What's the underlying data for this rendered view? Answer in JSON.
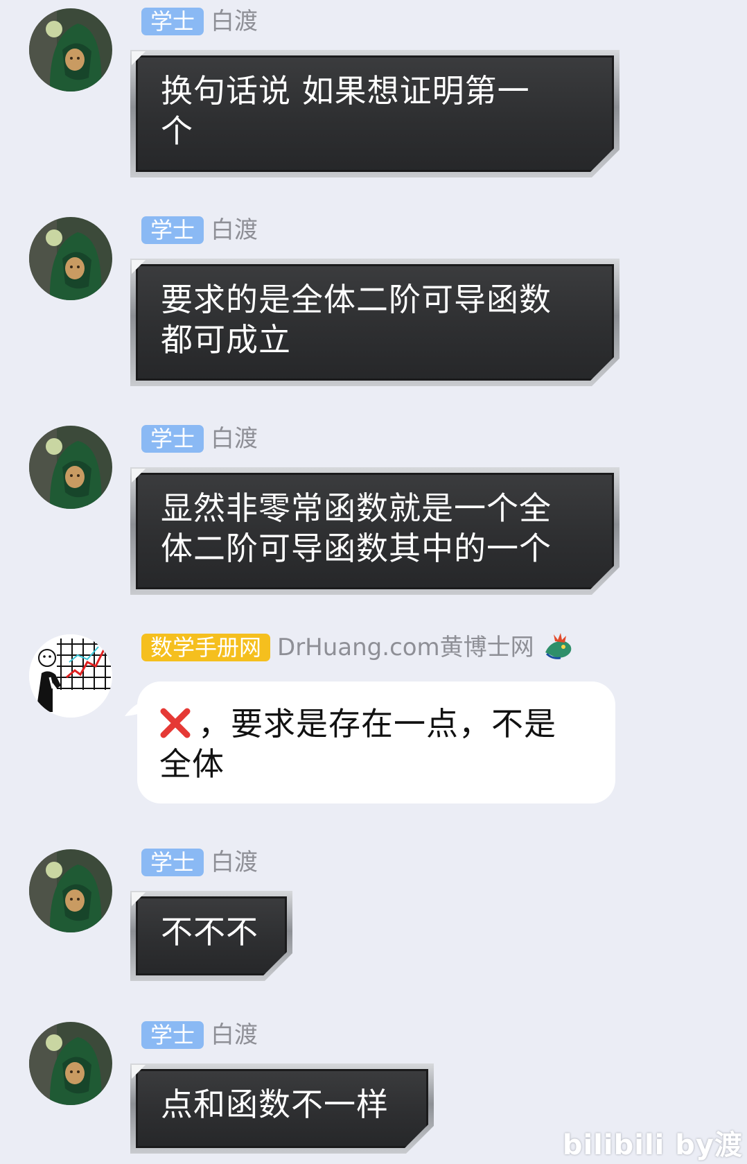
{
  "messages": [
    {
      "badge": "学士",
      "sender": "白渡",
      "text_lines": [
        "换句话说 如果想证明第一",
        "个"
      ]
    },
    {
      "badge": "学士",
      "sender": "白渡",
      "text_lines": [
        "要求的是全体二阶可导函数",
        "都可成立"
      ]
    },
    {
      "badge": "学士",
      "sender": "白渡",
      "text_lines": [
        "显然非零常函数就是一个全",
        "体二阶可导函数其中的一个"
      ]
    },
    {
      "badge": "数学手册网",
      "sender": "DrHuang.com黄博士网",
      "icon": "cross-icon",
      "text_lines": [
        "，要求是存在一点，不是",
        "全体"
      ]
    },
    {
      "badge": "学士",
      "sender": "白渡",
      "text_lines": [
        "不不不"
      ]
    },
    {
      "badge": "学士",
      "sender": "白渡",
      "text_lines": [
        "点和函数不一样"
      ]
    }
  ],
  "watermark": "bilibili by渡",
  "colors": {
    "background": "#ebedf5",
    "badge_blue": "#8ab9f4",
    "badge_gold": "#f5bf1e",
    "sender_gray": "#8e8f96",
    "cross_red": "#e53935"
  }
}
